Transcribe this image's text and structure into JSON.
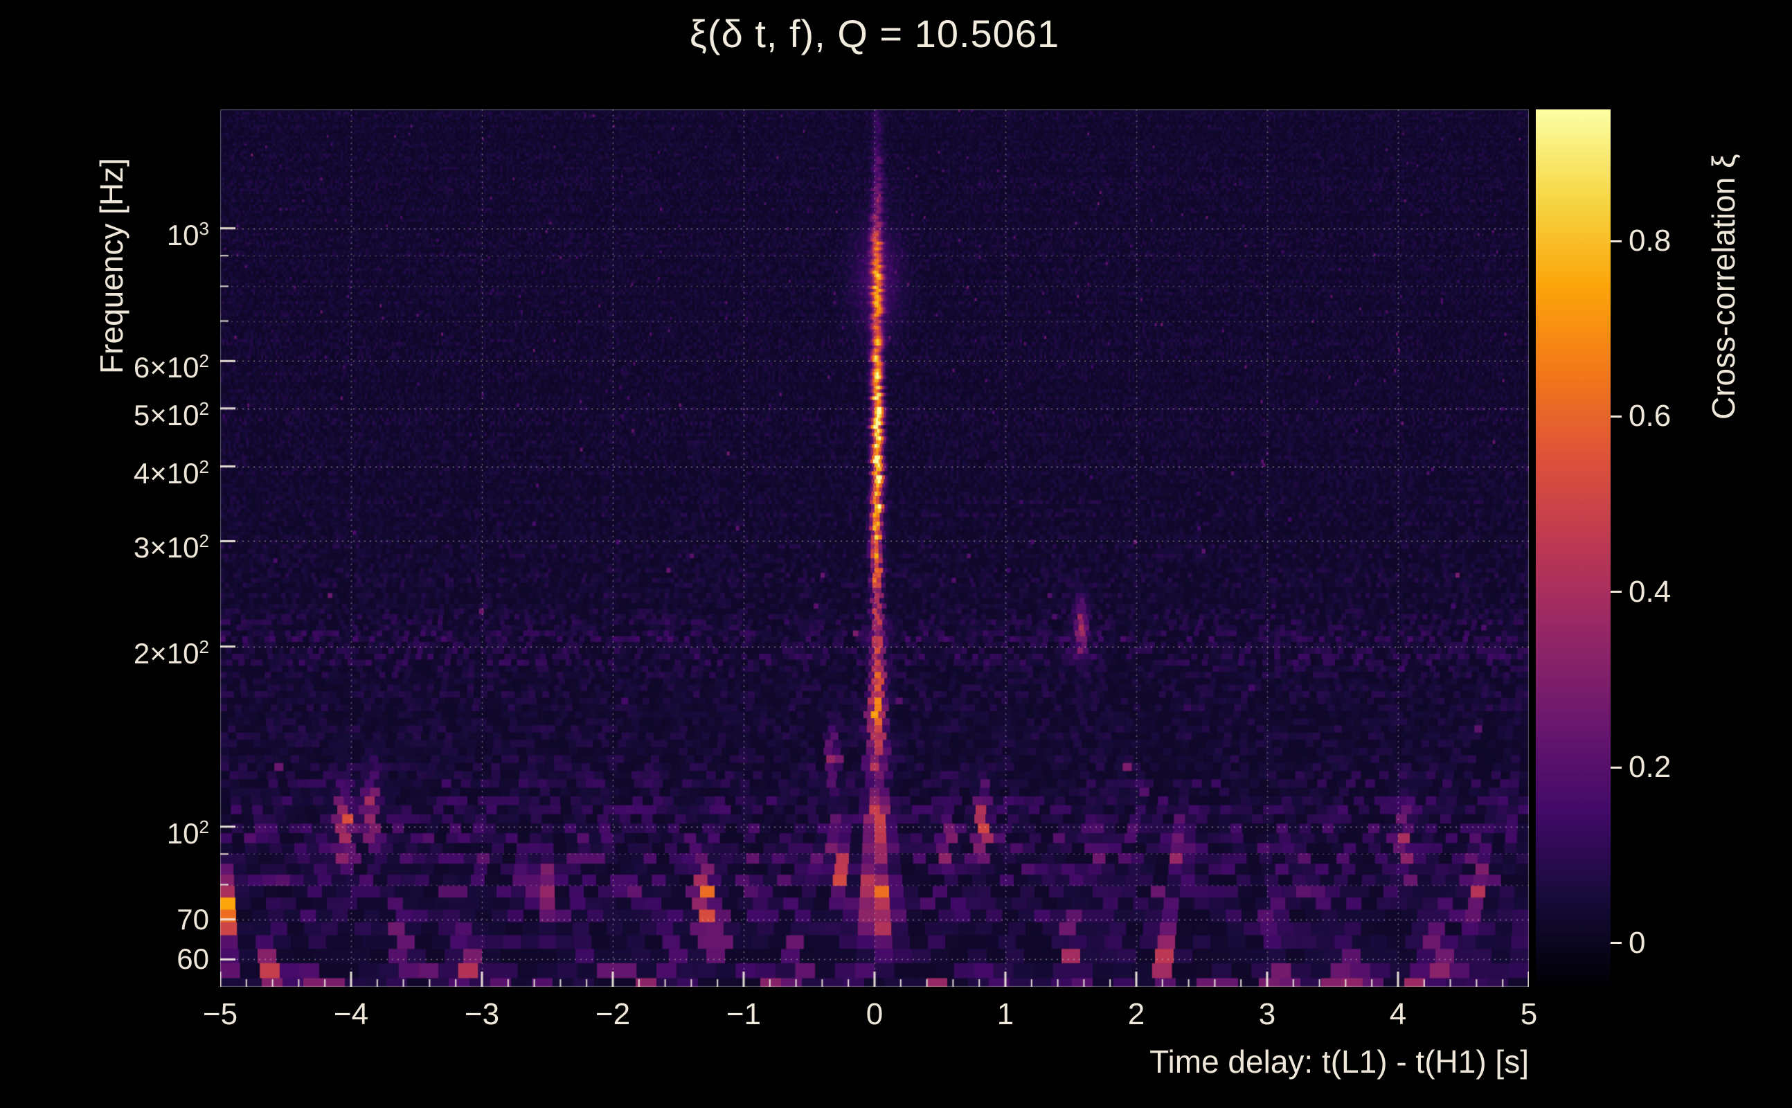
{
  "title": "ξ(δ t, f), Q = 10.5061",
  "axes": {
    "x_label": "Time delay: t(L1) - t(H1) [s]",
    "y_label": "Frequency [Hz]",
    "colorbar_label": "Cross-correlation ξ"
  },
  "chart_data": {
    "type": "heatmap",
    "title": "ξ(δ t, f), Q = 10.5061",
    "q_value": 10.5061,
    "xlabel": "Time delay: t(L1) - t(H1) [s]",
    "ylabel": "Frequency [Hz]",
    "colorbar_label": "Cross-correlation ξ",
    "colormap": "inferno",
    "x_range": [
      -5,
      5
    ],
    "y_range_hz": [
      54,
      1580
    ],
    "y_scale": "log",
    "x_major_ticks": [
      -5,
      -4,
      -3,
      -2,
      -1,
      0,
      1,
      2,
      3,
      4,
      5
    ],
    "x_tick_labels": [
      "−5",
      "−4",
      "−3",
      "−2",
      "−1",
      "0",
      "1",
      "2",
      "3",
      "4",
      "5"
    ],
    "x_minor_tick_step": 0.2,
    "y_major_ticks": [
      60,
      70,
      100,
      200,
      300,
      400,
      500,
      600,
      1000
    ],
    "y_tick_labels": [
      "60",
      "70",
      "10^2",
      "2×10^2",
      "3×10^2",
      "4×10^2",
      "5×10^2",
      "6×10^2",
      "10^3"
    ],
    "y_minor_ticks": [
      80,
      90,
      700,
      800,
      900
    ],
    "grid_x": [
      -4,
      -3,
      -2,
      -1,
      0,
      1,
      2,
      3,
      4
    ],
    "grid_y": [
      60,
      70,
      80,
      90,
      100,
      200,
      300,
      400,
      500,
      600,
      700,
      800,
      900,
      1000
    ],
    "grid_style": "dotted",
    "legend_position": "right",
    "colorbar_range": [
      -0.05,
      0.95
    ],
    "colorbar_ticks": [
      0,
      0.2,
      0.4,
      0.6,
      0.8
    ],
    "colorbar_tick_labels": [
      "0",
      "0.2",
      "0.4",
      "0.6",
      "0.8"
    ],
    "signal": {
      "time_delay_s": 0.02,
      "freq_band_hz": [
        55,
        950
      ],
      "peak_correlation": 0.92,
      "peak_freq_hz": 430,
      "bumps": [
        {
          "f": 430,
          "amp": 0.92,
          "wlog": 0.28
        },
        {
          "f": 155,
          "amp": 0.62,
          "wlog": 0.1
        },
        {
          "f": 100,
          "amp": 0.4,
          "wlog": 0.05
        },
        {
          "f": 75,
          "amp": 0.5,
          "wlog": 0.06
        },
        {
          "f": 870,
          "amp": 0.25,
          "wlog": 0.07
        },
        {
          "f": 1200,
          "amp": 0.1,
          "wlog": 0.15
        }
      ],
      "halo": {
        "f": 820,
        "amp": 0.12,
        "wlog": 0.09,
        "wt": 0.18
      }
    },
    "hotspots": [
      {
        "t": -4.95,
        "f": 72,
        "amp": 0.5,
        "wt": 0.05,
        "wf": 0.06
      },
      {
        "t": -4.62,
        "f": 60,
        "amp": 0.3,
        "wt": 0.05,
        "wf": 0.05
      },
      {
        "t": -4.05,
        "f": 100,
        "amp": 0.45,
        "wt": 0.06,
        "wf": 0.06
      },
      {
        "t": -3.85,
        "f": 108,
        "amp": 0.35,
        "wt": 0.05,
        "wf": 0.05
      },
      {
        "t": -3.62,
        "f": 62,
        "amp": 0.3,
        "wt": 0.06,
        "wf": 0.05
      },
      {
        "t": -3.1,
        "f": 60,
        "amp": 0.32,
        "wt": 0.07,
        "wf": 0.05
      },
      {
        "t": -2.5,
        "f": 78,
        "amp": 0.25,
        "wt": 0.05,
        "wf": 0.05
      },
      {
        "t": -2.28,
        "f": 60,
        "amp": 0.28,
        "wt": 0.05,
        "wf": 0.05
      },
      {
        "t": -1.55,
        "f": 60,
        "amp": 0.28,
        "wt": 0.05,
        "wf": 0.05
      },
      {
        "t": -1.3,
        "f": 74,
        "amp": 0.55,
        "wt": 0.06,
        "wf": 0.06
      },
      {
        "t": -1.18,
        "f": 66,
        "amp": 0.3,
        "wt": 0.05,
        "wf": 0.05
      },
      {
        "t": -0.6,
        "f": 58,
        "amp": 0.3,
        "wt": 0.05,
        "wf": 0.05
      },
      {
        "t": -0.28,
        "f": 88,
        "amp": 0.5,
        "wt": 0.05,
        "wf": 0.06
      },
      {
        "t": -0.32,
        "f": 130,
        "amp": 0.3,
        "wt": 0.04,
        "wf": 0.05
      },
      {
        "t": 0.55,
        "f": 95,
        "amp": 0.3,
        "wt": 0.04,
        "wf": 0.05
      },
      {
        "t": 0.82,
        "f": 100,
        "amp": 0.42,
        "wt": 0.05,
        "wf": 0.06
      },
      {
        "t": 1.5,
        "f": 62,
        "amp": 0.3,
        "wt": 0.05,
        "wf": 0.05
      },
      {
        "t": 1.58,
        "f": 215,
        "amp": 0.3,
        "wt": 0.05,
        "wf": 0.05
      },
      {
        "t": 2.2,
        "f": 64,
        "amp": 0.42,
        "wt": 0.06,
        "wf": 0.05
      },
      {
        "t": 2.35,
        "f": 92,
        "amp": 0.3,
        "wt": 0.05,
        "wf": 0.05
      },
      {
        "t": 3.05,
        "f": 70,
        "amp": 0.25,
        "wt": 0.05,
        "wf": 0.05
      },
      {
        "t": 3.62,
        "f": 60,
        "amp": 0.25,
        "wt": 0.05,
        "wf": 0.05
      },
      {
        "t": 4.05,
        "f": 95,
        "amp": 0.32,
        "wt": 0.05,
        "wf": 0.06
      },
      {
        "t": 4.3,
        "f": 62,
        "amp": 0.4,
        "wt": 0.06,
        "wf": 0.05
      },
      {
        "t": 4.62,
        "f": 78,
        "amp": 0.3,
        "wt": 0.05,
        "wf": 0.05
      }
    ],
    "noise": {
      "seed": 1337,
      "base": 0.02,
      "amp": 0.07,
      "low_freq_boost": 0.1
    }
  },
  "style": {
    "background": "#000000",
    "text_color": "#efe8da",
    "grid_color": "#ece5d8"
  }
}
